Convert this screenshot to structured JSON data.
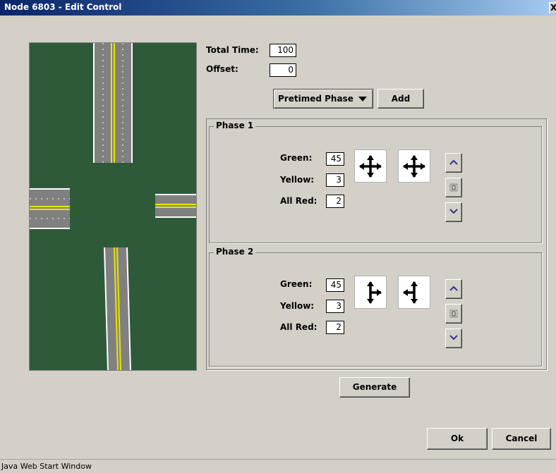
{
  "window": {
    "title": "Node 6803 - Edit Control",
    "close_label": "X"
  },
  "timing": {
    "total_time_label": "Total Time:",
    "total_time_value": "100",
    "offset_label": "Offset:",
    "offset_value": "0"
  },
  "phase_type": {
    "selected": "Pretimed Phase",
    "add_label": "Add"
  },
  "phases": [
    {
      "title": "Phase 1",
      "green_label": "Green:",
      "green": "45",
      "yellow_label": "Yellow:",
      "yellow": "3",
      "allred_label": "All Red:",
      "allred": "2",
      "movements": [
        "four-way-arrow-icon",
        "four-way-arrow-icon"
      ]
    },
    {
      "title": "Phase 2",
      "green_label": "Green:",
      "green": "45",
      "yellow_label": "Yellow:",
      "yellow": "3",
      "allred_label": "All Red:",
      "allred": "2",
      "movements": [
        "three-way-arrow-icon",
        "three-way-arrow-icon"
      ]
    }
  ],
  "actions": {
    "generate": "Generate",
    "ok": "Ok",
    "cancel": "Cancel"
  },
  "status": {
    "text": "Java Web Start Window"
  },
  "colors": {
    "title_start": "#0a246a",
    "title_end": "#a6caf0",
    "grass": "#2e5a3a",
    "road": "#808080",
    "center_line": "#e6e600"
  }
}
